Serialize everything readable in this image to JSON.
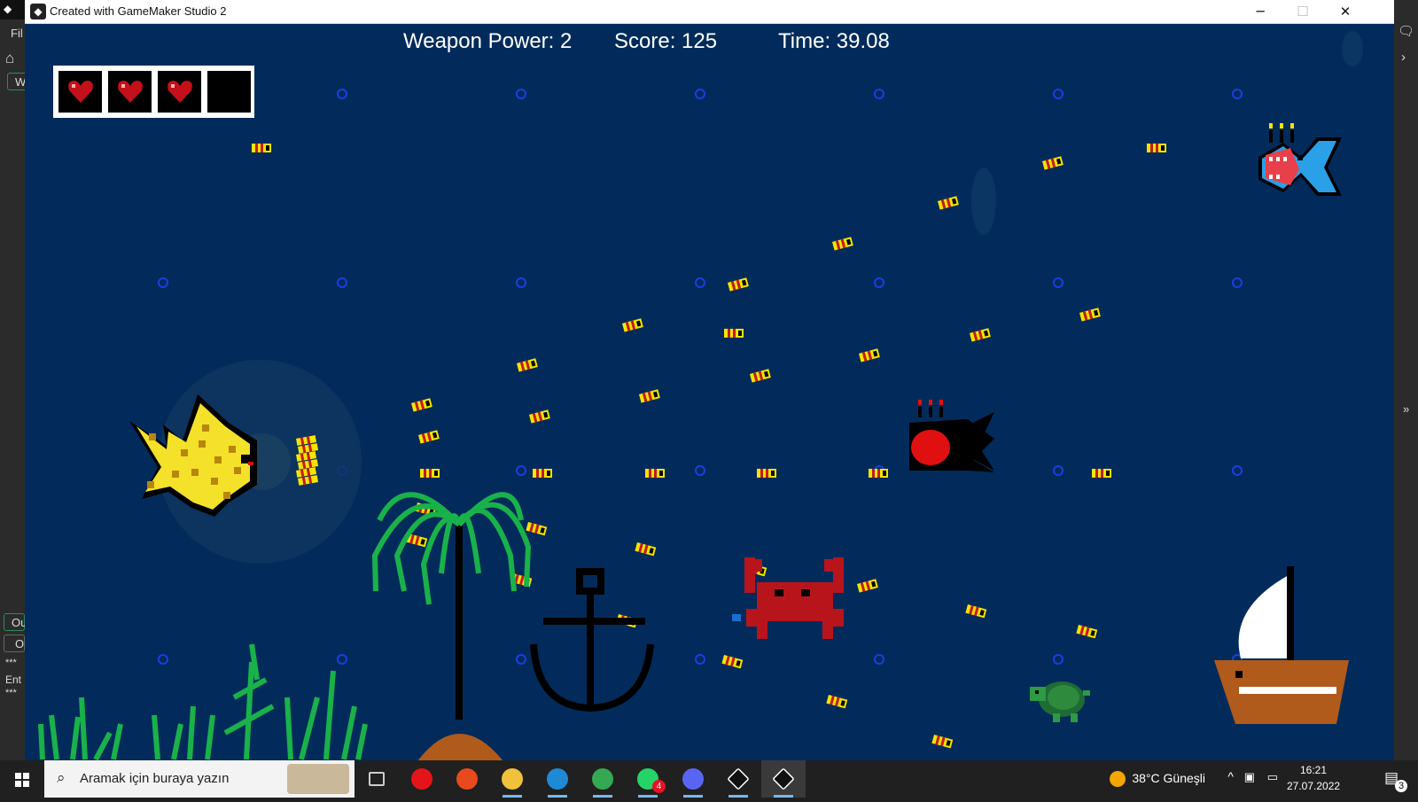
{
  "window": {
    "title": "Created with GameMaker Studio 2",
    "minimize": "─",
    "maximize": "☐",
    "close": "✕"
  },
  "ide": {
    "menu_file": "Fil",
    "tab_w": "W",
    "panel_ou": "Ou",
    "panel_o": "O",
    "stars1": "***",
    "ent": "Ent",
    "stars2": "***"
  },
  "hud": {
    "weapon_power": "Weapon Power: 2",
    "score": "Score: 125",
    "time": "Time: 39.08"
  },
  "health": {
    "hearts_total": 4,
    "hearts_filled": 3
  },
  "taskbar": {
    "search_placeholder": "Aramak için buraya yazın",
    "weather": "38°C  Güneşli",
    "time": "16:21",
    "date": "27.07.2022",
    "whatsapp_badge": "4",
    "notifications_badge": "3",
    "apps": [
      "task-view",
      "opera",
      "office",
      "file-explorer",
      "edge",
      "chrome",
      "whatsapp",
      "discord",
      "gamemaker",
      "gamemaker-runner"
    ]
  },
  "colors": {
    "ocean": "#022b5b",
    "heart": "#c4101a",
    "bullet": "#f5e400",
    "taskbar": "#202020"
  }
}
